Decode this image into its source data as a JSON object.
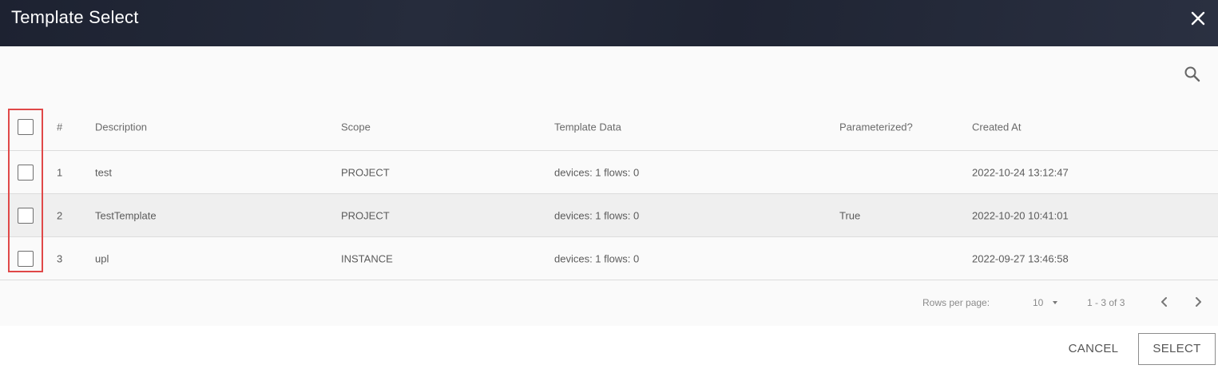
{
  "dialog": {
    "title": "Template Select"
  },
  "table": {
    "columns": {
      "index": "#",
      "description": "Description",
      "scope": "Scope",
      "template_data": "Template Data",
      "parameterized": "Parameterized?",
      "created_at": "Created At"
    },
    "rows": [
      {
        "index": "1",
        "description": "test",
        "scope": "PROJECT",
        "template_data": "devices: 1 flows: 0",
        "parameterized": "",
        "created_at": "2022-10-24 13:12:47"
      },
      {
        "index": "2",
        "description": "TestTemplate",
        "scope": "PROJECT",
        "template_data": "devices: 1 flows: 0",
        "parameterized": "True",
        "created_at": "2022-10-20 10:41:01"
      },
      {
        "index": "3",
        "description": "upl",
        "scope": "INSTANCE",
        "template_data": "devices: 1 flows: 0",
        "parameterized": "",
        "created_at": "2022-09-27 13:46:58"
      }
    ]
  },
  "pagination": {
    "rows_per_page_label": "Rows per page:",
    "rows_per_page_value": "10",
    "range": "1 - 3 of 3"
  },
  "footer": {
    "cancel_label": "CANCEL",
    "select_label": "SELECT"
  },
  "icons": {
    "close": "close-icon",
    "search": "search-icon",
    "prev": "chevron-left-icon",
    "next": "chevron-right-icon",
    "dropdown": "caret-down-icon"
  },
  "colors": {
    "title_bar": "#232837",
    "highlight_box": "#e04848",
    "selected_row": "#efefef"
  }
}
